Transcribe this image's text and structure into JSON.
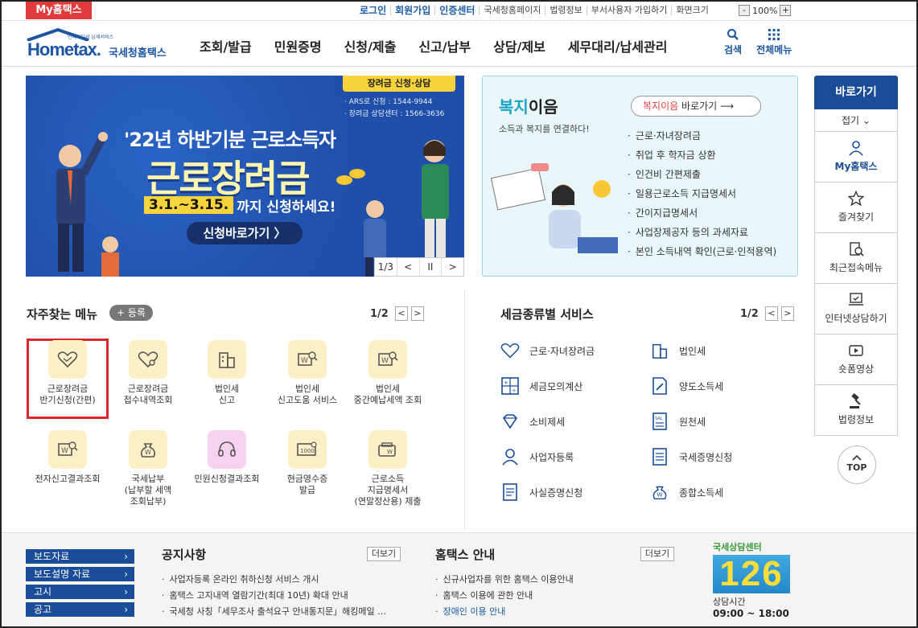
{
  "topbar": {
    "my_tab": "My홈택스",
    "links": [
      "로그인",
      "회원가입",
      "인증센터",
      "국세청홈페이지",
      "법령정보",
      "부서사용자 가입하기",
      "화면크기"
    ],
    "zoom_minus": "-",
    "zoom_value": "100%",
    "zoom_plus": "+"
  },
  "logo": {
    "main": "Hometax.",
    "sub": "국세청홈택스",
    "tiny": "언제어디서 납세서비스"
  },
  "gnb": [
    "조회/발급",
    "민원증명",
    "신청/제출",
    "신고/납부",
    "상담/제보",
    "세무대리/납세관리"
  ],
  "header_icons": {
    "search": "검색",
    "all_menu": "전체메뉴"
  },
  "banner": {
    "tag": "장려금 신청·상담",
    "ars": "· ARS로 신청 : 1544-9944",
    "center": "· 장려금 상담센터 : 1566-3636",
    "headline": "'22년 하반기분 근로소득자",
    "big": "근로장려금",
    "date_hl": "3.1.~3.15.",
    "date_rest": "까지 신청하세요!",
    "button": "신청바로가기 〉",
    "page": "1/3",
    "prev": "<",
    "pause": "II",
    "next": ">"
  },
  "welfare": {
    "title_a": "복지",
    "title_b": "이음",
    "subtitle": "소득과 복지를 연결하다!",
    "button_a": "복지이음",
    "button_b": " 바로가기 ⟶",
    "items": [
      "근로·자녀장려금",
      "취업 후 학자금 상환",
      "인건비 간편제출",
      "일용근로소득 지급명세서",
      "간이지급명세서",
      "사업장제공자 등의 과세자료",
      "본인 소득내역 확인(근로·인적용역)"
    ]
  },
  "quick": {
    "head": "바로가기",
    "fold": "접기 ⌄",
    "items": [
      "My홈택스",
      "즐겨찾기",
      "최근접속메뉴",
      "인터넷상담하기",
      "숏폼영상",
      "법령정보"
    ],
    "top": "TOP"
  },
  "frequent": {
    "title": "자주찾는 메뉴",
    "add": "+ 등록",
    "page": "1/2",
    "prev": "<",
    "next": ">",
    "items": [
      [
        "근로장려금",
        "반기신청(간편)"
      ],
      [
        "근로장려금",
        "접수내역조회"
      ],
      [
        "법인세",
        "신고"
      ],
      [
        "법인세",
        "신고도움 서비스"
      ],
      [
        "법인세",
        "중간예납세액 조회"
      ],
      [
        "전자신고결과조회"
      ],
      [
        "국세납부",
        "(납부할 세액",
        "조회납부)"
      ],
      [
        "민원신청결과조회"
      ],
      [
        "현금영수증",
        "발급"
      ],
      [
        "근로소득",
        "지급명세서",
        "(연말정산용) 제출"
      ]
    ]
  },
  "taxsvc": {
    "title": "세금종류별 서비스",
    "page": "1/2",
    "prev": "<",
    "next": ">",
    "left": [
      "근로·자녀장려금",
      "세금모의계산",
      "소비제세",
      "사업자등록",
      "사실증명신청"
    ],
    "right": [
      "법인세",
      "양도소득세",
      "원천세",
      "국세증명신청",
      "종합소득세"
    ]
  },
  "bottom": {
    "nav": [
      "보도자료",
      "보도설명 자료",
      "고시",
      "공고"
    ],
    "notice_title": "공지사항",
    "notice_more": "더보기",
    "notices": [
      "사업자등록 온라인 취하신청 서비스 개시",
      "홈택스 고지내역 열람기간(최대 10년) 확대 안내",
      "국세청 사칭「세무조사 출석요구 안내통지문」해킹메일 …"
    ],
    "guide_title": "홈택스 안내",
    "guide_more": "더보기",
    "guides": [
      "신규사업자를 위한 홈택스 이용안내",
      "홈택스 이용에 관한 안내",
      "장애인 이용 안내"
    ],
    "call_label": "국세상담센터",
    "call_number": "126",
    "call_hours_label": "상담시간",
    "call_hours": "09:00 ~ 18:00"
  },
  "colors": {
    "brand": "#1a4c9a",
    "alert": "#e03a3a",
    "highlight": "#d8282a",
    "banner": "#1f4fa9"
  }
}
